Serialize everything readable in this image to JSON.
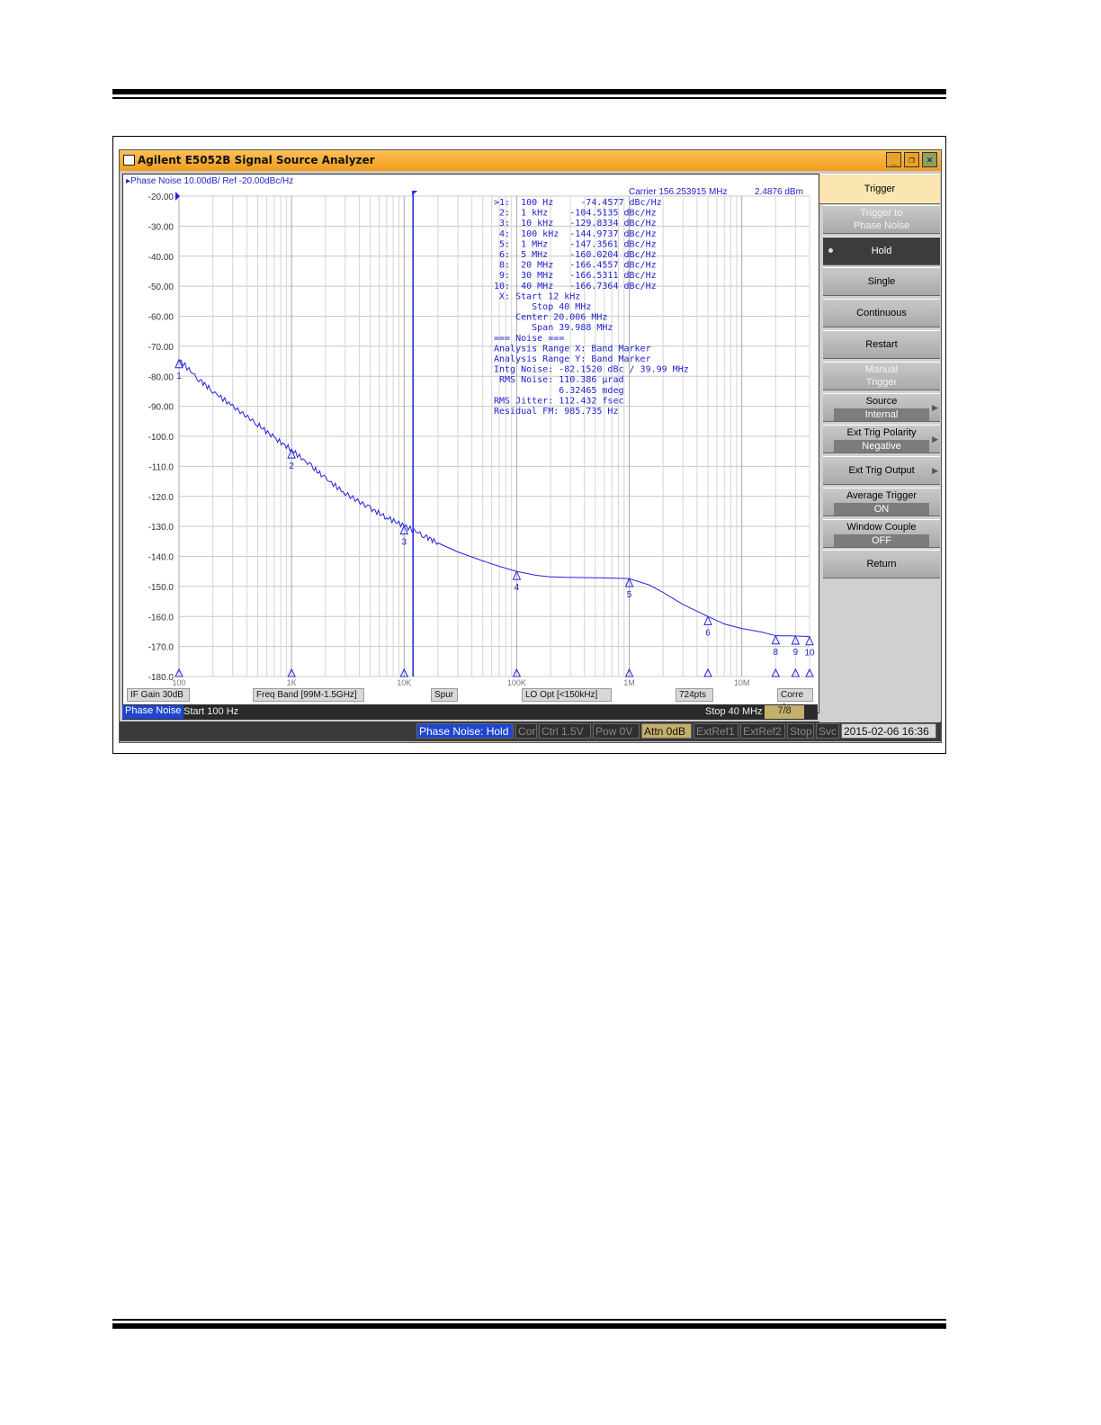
{
  "window": {
    "title": "Agilent E5052B Signal Source Analyzer",
    "buttons": [
      "_",
      "❐",
      "✕"
    ]
  },
  "trace_header": "Phase Noise 10.00dB/ Ref -20.00dBc/Hz",
  "carrier": {
    "freq": "Carrier 156.253915 MHz",
    "power": "2.4876 dBm"
  },
  "marker_table": [
    ">1:  100 Hz     -74.4577 dBc/Hz",
    " 2:  1 kHz    -104.5135 dBc/Hz",
    " 3:  10 kHz   -129.8334 dBc/Hz",
    " 4:  100 kHz  -144.9737 dBc/Hz",
    " 5:  1 MHz    -147.3561 dBc/Hz",
    " 6:  5 MHz    -160.0204 dBc/Hz",
    " 8:  20 MHz   -166.4557 dBc/Hz",
    " 9:  30 MHz   -166.5311 dBc/Hz",
    "10:  40 MHz   -166.7364 dBc/Hz",
    " X: Start 12 kHz",
    "       Stop 40 MHz",
    "    Center 20.006 MHz",
    "       Span 39.988 MHz",
    "=== Noise ===",
    "Analysis Range X: Band Marker",
    "Analysis Range Y: Band Marker",
    "Intg Noise: -82.1520 dBc / 39.99 MHz",
    " RMS Noise: 110.386 µrad",
    "            6.32465 mdeg",
    "RMS Jitter: 112.432 fsec",
    "Residual FM: 985.735 Hz"
  ],
  "chart_data": {
    "type": "line",
    "x_scale": "log",
    "xlim": [
      100,
      40000000
    ],
    "ylim": [
      -180,
      -20
    ],
    "y_ticks": [
      "-20.00",
      "-30.00",
      "-40.00",
      "-50.00",
      "-60.00",
      "-70.00",
      "-80.00",
      "-90.00",
      "-100.0",
      "-110.0",
      "-120.0",
      "-130.0",
      "-140.0",
      "-150.0",
      "-160.0",
      "-170.0",
      "-180.0"
    ],
    "x_tick_labels": [
      {
        "label": "100",
        "x": 100
      },
      {
        "label": "1K",
        "x": 1000
      },
      {
        "label": "10K",
        "x": 10000
      },
      {
        "label": "100K",
        "x": 100000
      },
      {
        "label": "1M",
        "x": 1000000
      },
      {
        "label": "10M",
        "x": 10000000
      }
    ],
    "grid": true,
    "series": [
      {
        "color": "#2222dd",
        "x": [
          100,
          150,
          200,
          300,
          500,
          700,
          1000,
          1500,
          2000,
          3000,
          5000,
          7000,
          10000,
          15000,
          20000,
          30000,
          50000,
          70000,
          100000,
          150000,
          200000,
          300000,
          500000,
          700000,
          1000000,
          1500000,
          2000000,
          3000000,
          5000000,
          7000000,
          10000000,
          15000000,
          20000000,
          30000000,
          40000000
        ],
        "y": [
          -74.5,
          -81,
          -85,
          -90,
          -96,
          -100.5,
          -104.5,
          -110,
          -114,
          -119,
          -124,
          -127,
          -129.8,
          -133,
          -135.5,
          -138.5,
          -141.5,
          -143.3,
          -145,
          -146.3,
          -146.8,
          -147,
          -147.1,
          -147.2,
          -147.4,
          -149.5,
          -152,
          -156,
          -160,
          -162.5,
          -164,
          -165.2,
          -166.4,
          -166.5,
          -166.7
        ]
      }
    ],
    "markers": [
      {
        "label": "1",
        "x": 100,
        "y": -74.4577
      },
      {
        "label": "2",
        "x": 1000,
        "y": -104.5135
      },
      {
        "label": "3",
        "x": 10000,
        "y": -129.8334
      },
      {
        "label": "4",
        "x": 100000,
        "y": -144.9737
      },
      {
        "label": "5",
        "x": 1000000,
        "y": -147.3561
      },
      {
        "label": "6",
        "x": 5000000,
        "y": -160.0204
      },
      {
        "label": "8",
        "x": 20000000,
        "y": -166.4557
      },
      {
        "label": "9",
        "x": 30000000,
        "y": -166.5311
      },
      {
        "label": "10",
        "x": 40000000,
        "y": -166.7364
      }
    ],
    "band_start": 12000
  },
  "status": {
    "if_gain": "IF Gain 30dB",
    "freq_band": "Freq Band [99M-1.5GHz]",
    "spur": "Spur",
    "lo_opt": "LO Opt [<150kHz]",
    "points": "724pts",
    "corr": "Corre 4"
  },
  "info": {
    "mode": "Phase Noise",
    "start": "Start 100 Hz",
    "stop": "Stop 40 MHz",
    "page": "7/8"
  },
  "bottom": {
    "state": "Phase Noise: Hold",
    "cor": "Cor",
    "ctrl": "Ctrl  1.5V",
    "pow": "Pow  0V",
    "attn": "Attn 0dB",
    "extref1": "ExtRef1",
    "extref2": "ExtRef2",
    "stop": "Stop",
    "svc": "Svc",
    "datetime": "2015-02-06 16:36"
  },
  "softkeys": {
    "trigger": "Trigger",
    "trigger_to_1": "Trigger to",
    "trigger_to_2": "Phase Noise",
    "hold": "Hold",
    "single": "Single",
    "continuous": "Continuous",
    "restart": "Restart",
    "manual_1": "Manual",
    "manual_2": "Trigger",
    "source": "Source",
    "source_val": "Internal",
    "polarity": "Ext Trig Polarity",
    "polarity_val": "Negative",
    "ext_out": "Ext Trig Output",
    "avg": "Average Trigger",
    "avg_val": "ON",
    "window": "Window Couple",
    "window_val": "OFF",
    "ret": "Return"
  },
  "colors": {
    "trace": "#2222dd",
    "title_bar": "#f5a623",
    "hold_active": "#3c3c3c"
  }
}
